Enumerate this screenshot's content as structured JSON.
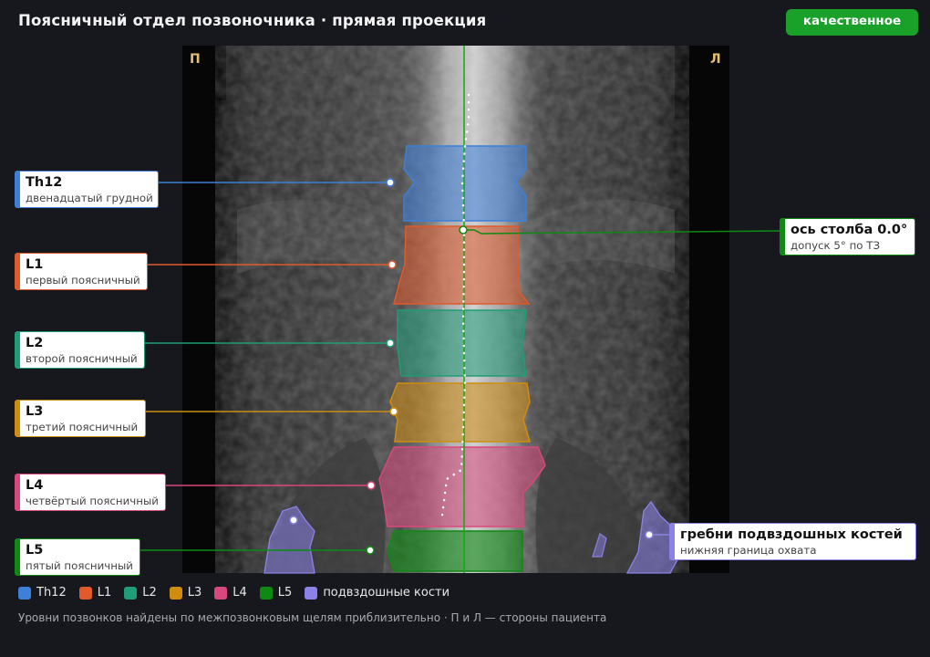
{
  "header": {
    "title": "Поясничный отдел позвоночника · прямая проекция",
    "quality_badge": "качественное"
  },
  "sides": {
    "right": "П",
    "left": "Л"
  },
  "vertebrae": [
    {
      "id": "Th12",
      "name": "Th12",
      "desc": "двенадцатый грудной",
      "color": "#3d7fd9"
    },
    {
      "id": "L1",
      "name": "L1",
      "desc": "первый поясничный",
      "color": "#e05a2b"
    },
    {
      "id": "L2",
      "name": "L2",
      "desc": "второй поясничный",
      "color": "#1f9c78"
    },
    {
      "id": "L3",
      "name": "L3",
      "desc": "третий поясничный",
      "color": "#d08c10"
    },
    {
      "id": "L4",
      "name": "L4",
      "desc": "четвёртый поясничный",
      "color": "#d9487c"
    },
    {
      "id": "L5",
      "name": "L5",
      "desc": "пятый поясничный",
      "color": "#0e8a12"
    }
  ],
  "axis_callout": {
    "name": "ось столба 0.0°",
    "desc": "допуск 5° по ТЗ",
    "color": "#0e8a12"
  },
  "iliac_callout": {
    "name": "гребни подвздошных костей",
    "desc": "нижняя граница охвата",
    "color": "#8a82e6"
  },
  "legend": [
    {
      "label": "Th12",
      "color": "#3d7fd9"
    },
    {
      "label": "L1",
      "color": "#e05a2b"
    },
    {
      "label": "L2",
      "color": "#1f9c78"
    },
    {
      "label": "L3",
      "color": "#d08c10"
    },
    {
      "label": "L4",
      "color": "#d9487c"
    },
    {
      "label": "L5",
      "color": "#0e8a12"
    },
    {
      "label": "подвздошные кости",
      "color": "#8a82e6"
    }
  ],
  "footnote": "Уровни позвонков найдены по межпозвонковым щелям приблизительно · П и Л — стороны пациента"
}
